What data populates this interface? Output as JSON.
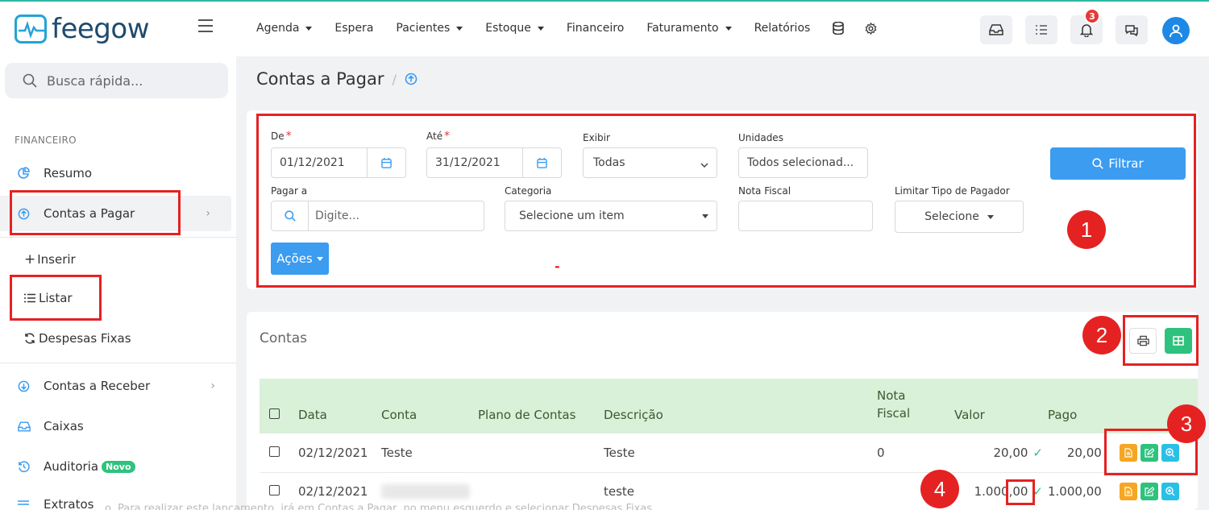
{
  "app": {
    "brand": "feegow"
  },
  "topnav": {
    "items": [
      {
        "label": "Agenda",
        "dropdown": true
      },
      {
        "label": "Espera",
        "dropdown": false
      },
      {
        "label": "Pacientes",
        "dropdown": true
      },
      {
        "label": "Estoque",
        "dropdown": true
      },
      {
        "label": "Financeiro",
        "dropdown": false
      },
      {
        "label": "Faturamento",
        "dropdown": true
      },
      {
        "label": "Relatórios",
        "dropdown": false
      }
    ],
    "notification_count": "3"
  },
  "sidebar": {
    "search_placeholder": "Busca rápida...",
    "section_title": "FINANCEIRO",
    "items": {
      "resumo": "Resumo",
      "contas_pagar": "Contas a Pagar",
      "inserir": "Inserir",
      "listar": "Listar",
      "despesas_fixas": "Despesas Fixas",
      "contas_receber": "Contas a Receber",
      "caixas": "Caixas",
      "auditoria": "Auditoria",
      "auditoria_badge": "Novo",
      "extratos": "Extratos"
    }
  },
  "page": {
    "title": "Contas a Pagar",
    "separator": "/"
  },
  "filters": {
    "de_label": "De",
    "de_value": "01/12/2021",
    "ate_label": "Até",
    "ate_value": "31/12/2021",
    "exibir_label": "Exibir",
    "exibir_value": "Todas",
    "unidades_label": "Unidades",
    "unidades_value": "Todos selecionad...",
    "filtrar_label": "Filtrar",
    "pagar_a_label": "Pagar a",
    "pagar_a_placeholder": "Digite...",
    "categoria_label": "Categoria",
    "categoria_value": "Selecione um item",
    "nota_fiscal_label": "Nota Fiscal",
    "limitar_label": "Limitar Tipo de Pagador",
    "limitar_value": "Selecione",
    "acoes_label": "Ações",
    "stray_mark": "-"
  },
  "contas": {
    "title": "Contas",
    "columns": {
      "data": "Data",
      "conta": "Conta",
      "plano": "Plano de Contas",
      "descricao": "Descrição",
      "nota_line1": "Nota",
      "nota_line2": "Fiscal",
      "valor": "Valor",
      "pago": "Pago"
    },
    "rows": [
      {
        "data": "02/12/2021",
        "conta": "Teste",
        "plano": "",
        "descricao": "Teste",
        "nota": "0",
        "valor": "20,00",
        "pago": "20,00"
      },
      {
        "data": "02/12/2021",
        "conta": "",
        "plano": "",
        "descricao": "teste",
        "nota": "",
        "valor": "1.000,00",
        "pago": "1.000,00"
      }
    ]
  },
  "annotations": {
    "n1": "1",
    "n2": "2",
    "n3": "3",
    "n4": "4"
  },
  "caption": "o. Para realizar este lançamento, irá em Contas a Pagar, no menu esquerdo e selecionar Despesas Fixas",
  "colors": {
    "primary": "#3b9cf0",
    "success": "#2ec27e",
    "warning": "#f5a623",
    "info": "#29c0e8",
    "annotation": "#e52222"
  }
}
